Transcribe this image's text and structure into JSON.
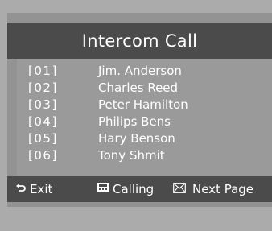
{
  "title": "Intercom Call",
  "entries": [
    {
      "num": "[01]",
      "name": "Jim. Anderson"
    },
    {
      "num": "[02]",
      "name": "Charles Reed"
    },
    {
      "num": "[03]",
      "name": "Peter Hamilton"
    },
    {
      "num": "[04]",
      "name": "Philips Bens"
    },
    {
      "num": "[05]",
      "name": "Hary Benson"
    },
    {
      "num": "[06]",
      "name": "Tony Shmit"
    }
  ],
  "footer": {
    "exit_label": "Exit",
    "calling_label": "Calling",
    "next_page_label": "Next Page"
  },
  "colors": {
    "background": "#ababab",
    "panel": "#939393",
    "bar": "#4b4b4b",
    "text": "#ffffff"
  },
  "icons": [
    "back-arrow-icon",
    "phone-icon",
    "mail-icon"
  ]
}
